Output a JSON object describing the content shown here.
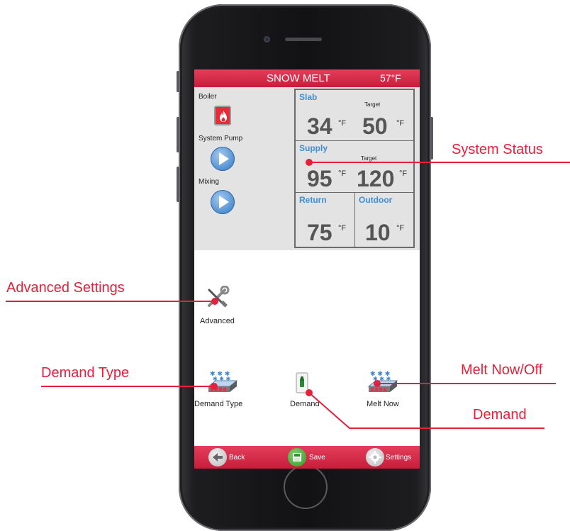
{
  "header": {
    "title": "SNOW MELT",
    "outdoor_temp": "57°F"
  },
  "equipment": [
    {
      "label": "Boiler",
      "icon": "boiler-flame-icon"
    },
    {
      "label": "System Pump",
      "icon": "pump-play-icon"
    },
    {
      "label": "Mixing",
      "icon": "mixing-play-icon"
    }
  ],
  "status": {
    "slab": {
      "label": "Slab",
      "value": "34",
      "target_label": "Target",
      "target": "50",
      "unit": "°F"
    },
    "supply": {
      "label": "Supply",
      "value": "95",
      "target_label": "Target",
      "target": "120",
      "unit": "°F"
    },
    "return": {
      "label": "Return",
      "value": "75",
      "unit": "°F"
    },
    "outdoor": {
      "label": "Outdoor",
      "value": "10",
      "unit": "°F"
    }
  },
  "apps": {
    "advanced": {
      "label": "Advanced",
      "icon": "wrench-screwdriver-icon"
    },
    "demand_type": {
      "label": "Demand Type",
      "icon": "heated-slab-icon"
    },
    "demand": {
      "label": "Demand",
      "icon": "switch-icon"
    },
    "melt_now": {
      "label": "Melt Now",
      "icon": "heated-slab-icon"
    }
  },
  "bottom_bar": {
    "back": "Back",
    "save": "Save",
    "settings": "Settings"
  },
  "callouts": {
    "system_status": "System Status",
    "advanced_settings": "Advanced Settings",
    "demand_type": "Demand Type",
    "melt_now_off": "Melt Now/Off",
    "demand": "Demand"
  },
  "colors": {
    "accent_red": "#d42a47",
    "callout_red": "#e6203a",
    "label_blue": "#3e8fd6",
    "panel_gray": "#e3e3e3"
  }
}
